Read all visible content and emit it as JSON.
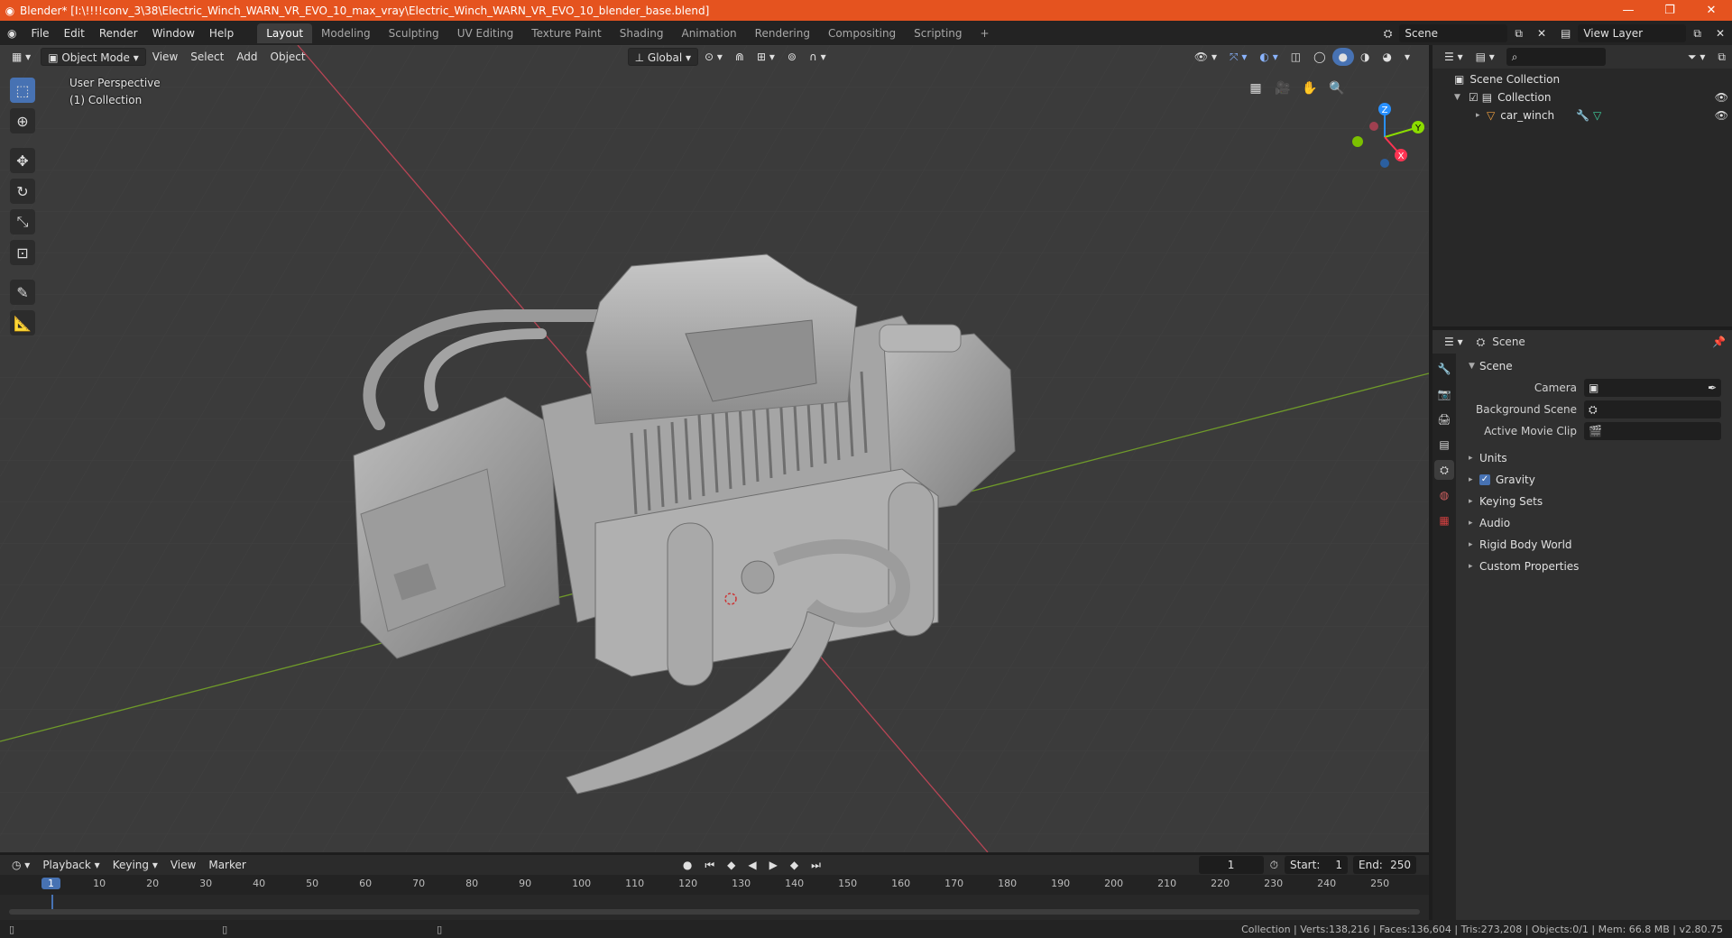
{
  "titlebar": {
    "title": "Blender* [I:\\!!!!conv_3\\38\\Electric_Winch_WARN_VR_EVO_10_max_vray\\Electric_Winch_WARN_VR_EVO_10_blender_base.blend]",
    "minimize": "—",
    "maximize": "❐",
    "close": "✕"
  },
  "menu": [
    "File",
    "Edit",
    "Render",
    "Window",
    "Help"
  ],
  "workspaces": [
    "Layout",
    "Modeling",
    "Sculpting",
    "UV Editing",
    "Texture Paint",
    "Shading",
    "Animation",
    "Rendering",
    "Compositing",
    "Scripting"
  ],
  "scene_field": "Scene",
  "view_layer_field": "View Layer",
  "viewport": {
    "mode": "Object Mode",
    "menus": [
      "View",
      "Select",
      "Add",
      "Object"
    ],
    "transform_orientation": "Global",
    "overlay_line1": "User Perspective",
    "overlay_line2": "(1) Collection",
    "gizmo_axes": {
      "x": "X",
      "y": "Y",
      "z": "Z"
    }
  },
  "outliner": {
    "scene_collection": "Scene Collection",
    "collection": "Collection",
    "object": "car_winch"
  },
  "properties": {
    "header": "Scene",
    "section": "Scene",
    "rows": [
      {
        "label": "Camera",
        "value": ""
      },
      {
        "label": "Background Scene",
        "value": ""
      },
      {
        "label": "Active Movie Clip",
        "value": ""
      }
    ],
    "panels": [
      "Units",
      "Gravity",
      "Keying Sets",
      "Audio",
      "Rigid Body World",
      "Custom Properties"
    ],
    "gravity_checked": true
  },
  "timeline": {
    "menus": [
      "Playback",
      "Keying",
      "View",
      "Marker"
    ],
    "current_frame": "1",
    "start_label": "Start:",
    "start": "1",
    "end_label": "End:",
    "end": "250",
    "ticks": [
      "1",
      "10",
      "20",
      "30",
      "40",
      "50",
      "60",
      "70",
      "80",
      "90",
      "100",
      "110",
      "120",
      "130",
      "140",
      "150",
      "160",
      "170",
      "180",
      "190",
      "200",
      "210",
      "220",
      "230",
      "240",
      "250"
    ]
  },
  "statusbar": {
    "text": "Collection | Verts:138,216 | Faces:136,604 | Tris:273,208 | Objects:0/1 | Mem: 66.8 MB | v2.80.75"
  },
  "colors": {
    "accent": "#4772b3",
    "titlebar": "#e5531f",
    "x_axis": "#ff3352",
    "y_axis": "#8bdc00",
    "z_axis": "#2890ff"
  }
}
